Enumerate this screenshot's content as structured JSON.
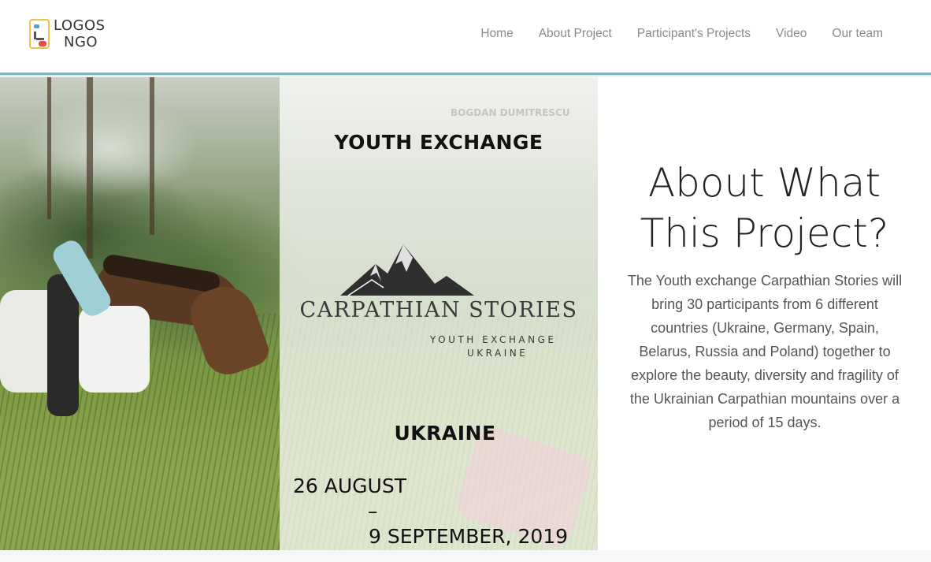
{
  "logo": {
    "line1": "LOGOS",
    "line2": "NGO"
  },
  "nav": [
    {
      "label": "Home"
    },
    {
      "label": "About Project"
    },
    {
      "label": "Participant's Projects"
    },
    {
      "label": "Video"
    },
    {
      "label": "Our team"
    }
  ],
  "hero": {
    "watermark": "BOGDAN DUMITRESCU",
    "title": "YOUTH EXCHANGE",
    "brand": "CARPATHIAN STORIES",
    "brand_sub1": "YOUTH EXCHANGE",
    "brand_sub2": "UKRAINE",
    "country": "UKRAINE",
    "date_start": "26 AUGUST",
    "date_dash": "–",
    "date_end": "9 SEPTEMBER, 2019"
  },
  "about": {
    "title_line1": "About What",
    "title_line2": "This Project?",
    "text": "The Youth exchange Carpathian Stories will bring 30 participants from 6 different countries (Ukraine, Germany, Spain, Belarus, Russia and Poland) together to explore the beauty, diversity and fragility of the Ukrainian Carpathian mountains over a period of 15 days."
  },
  "colors": {
    "accent_line": "#7fb5c4",
    "logo_border": "#f0c14b",
    "logo_blue": "#4aa3d8",
    "logo_red": "#e34b4b"
  }
}
